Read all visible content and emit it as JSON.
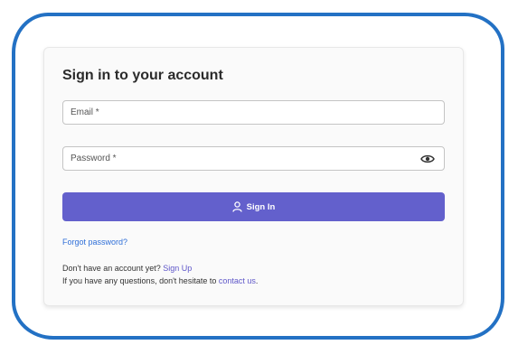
{
  "login": {
    "title": "Sign in to your account",
    "email_placeholder": "Email *",
    "email_value": "",
    "password_placeholder": "Password *",
    "password_value": "",
    "password_toggle_icon": "eye-icon",
    "signin_icon": "user-icon",
    "signin_label": "Sign In",
    "forgot_label": "Forgot password?",
    "no_account_text": "Don't have an account yet? ",
    "signup_label": "Sign Up",
    "questions_text": "If you have any questions, don't hesitate to ",
    "contact_label": "contact us",
    "contact_suffix": "."
  },
  "colors": {
    "frame_border": "#2371c4",
    "primary_button": "#6360cc",
    "link_blue": "#2f6fd8",
    "link_purple": "#5f57c9"
  }
}
